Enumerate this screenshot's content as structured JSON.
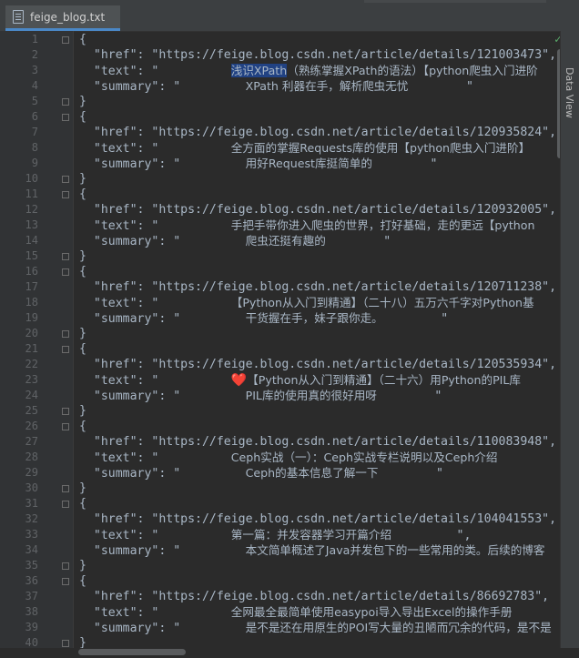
{
  "tab": {
    "filename": "feige_blog.txt",
    "close": "×"
  },
  "sidebar": {
    "label": "Data View"
  },
  "gutter": {
    "line_numbers": [
      1,
      2,
      3,
      4,
      5,
      6,
      7,
      8,
      9,
      10,
      11,
      12,
      13,
      14,
      15,
      16,
      17,
      18,
      19,
      20,
      21,
      22,
      23,
      24,
      25,
      26,
      27,
      28,
      29,
      30,
      31,
      32,
      33,
      34,
      35,
      36,
      37,
      38,
      39,
      40
    ]
  },
  "status": {
    "check": "✓"
  },
  "entries": [
    {
      "href": "https://feige.blog.csdn.net/article/details/121003473",
      "text_selected": "浅识XPath",
      "text": "（熟练掌握XPath的语法）【python爬虫入门进阶",
      "summary": "XPath 利器在手，解析爬虫无忧"
    },
    {
      "href": "https://feige.blog.csdn.net/article/details/120935824",
      "text": "全方面的掌握Requests库的使用【python爬虫入门进阶】",
      "summary": "用好Request库挺简单的"
    },
    {
      "href": "https://feige.blog.csdn.net/article/details/120932005",
      "text": "手把手带你进入爬虫的世界，打好基础，走的更远【python",
      "summary": "爬虫还挺有趣的"
    },
    {
      "href": "https://feige.blog.csdn.net/article/details/120711238",
      "text": "【Python从入门到精通】（二十八）五万六千字对Python基",
      "summary": "干货握在手，妹子跟你走。"
    },
    {
      "href": "https://feige.blog.csdn.net/article/details/120535934",
      "text_icon": "❤️",
      "text": "【Python从入门到精通】（二十六）用Python的PIL库",
      "summary": "PIL库的使用真的很好用呀"
    },
    {
      "href": "https://feige.blog.csdn.net/article/details/110083948",
      "text": "Ceph实战（一）：Ceph实战专栏说明以及Ceph介绍",
      "summary": "Ceph的基本信息了解一下"
    },
    {
      "href": "https://feige.blog.csdn.net/article/details/104041553",
      "text": "第一篇：并发容器学习开篇介绍",
      "text_tail": "\",",
      "summary": "本文简单概述了Java并发包下的一些常用的类。后续的博客"
    },
    {
      "href": "https://feige.blog.csdn.net/article/details/86692783",
      "text": "全网最全最简单使用easypoi导入导出Excel的操作手册",
      "summary": "是不是还在用原生的POI写大量的丑陋而冗余的代码，是不是"
    }
  ]
}
